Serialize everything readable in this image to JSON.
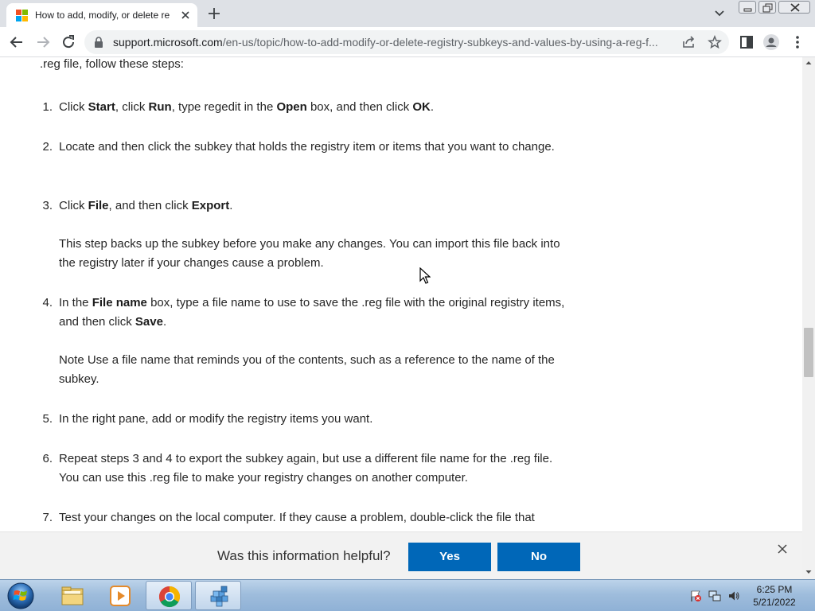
{
  "browser": {
    "tab": {
      "title": "How to add, modify, or delete re",
      "favicon": "microsoft-logo-icon"
    },
    "new_tab_label": "+",
    "address": {
      "domain": "support.microsoft.com",
      "path": "/en-us/topic/how-to-add-modify-or-delete-registry-subkeys-and-values-by-using-a-reg-f..."
    }
  },
  "article": {
    "intro": ".reg file, follow these steps:",
    "steps": [
      {
        "num": "1."
      },
      {
        "num": "2.",
        "text": "Locate and then click the subkey that holds the registry item or items that you want to change."
      },
      {
        "num": "3.",
        "note": "This step backs up the subkey before you make any changes. You can import this file back into the registry later if your changes cause a problem."
      },
      {
        "num": "4.",
        "note": "Note Use a file name that reminds you of the contents, such as a reference to the name of the subkey."
      },
      {
        "num": "5.",
        "text": "In the right pane, add or modify the registry items you want."
      },
      {
        "num": "6.",
        "text": "Repeat steps 3 and 4 to export the subkey again, but use a different file name for the .reg file. You can use this .reg file to make your registry changes on another computer."
      },
      {
        "num": "7.",
        "text": "Test your changes on the local computer. If they cause a problem, double-click the file that"
      }
    ],
    "step1_parts": [
      "Click ",
      "Start",
      ", click ",
      "Run",
      ", type regedit in the ",
      "Open",
      " box, and then click ",
      "OK",
      "."
    ],
    "step3_parts": [
      "Click ",
      "File",
      ", and then click ",
      "Export",
      "."
    ],
    "step4_parts": [
      "In the ",
      "File name",
      " box, type a file name to use to save the .reg file with the original registry items, and then click ",
      "Save",
      "."
    ]
  },
  "feedback": {
    "question": "Was this information helpful?",
    "yes_label": "Yes",
    "no_label": "No"
  },
  "taskbar": {
    "clock_time": "6:25 PM",
    "clock_date": "5/21/2022"
  },
  "colors": {
    "accent": "#0067b8",
    "tabstrip": "#dee1e6",
    "feedback_bg": "#f2f2f2"
  }
}
